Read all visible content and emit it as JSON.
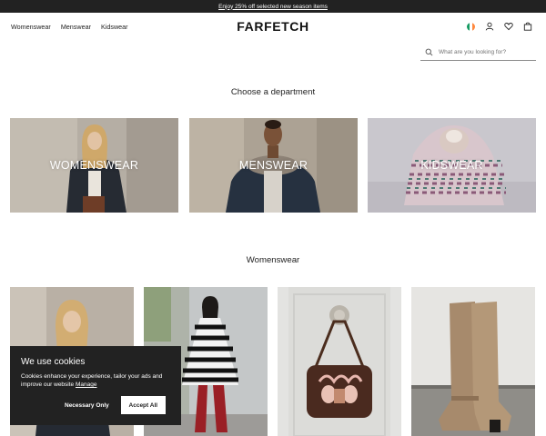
{
  "promo": {
    "text": "Enjoy 25% off selected new season items"
  },
  "header": {
    "nav": [
      "Womenswear",
      "Menswear",
      "Kidswear"
    ],
    "logo": "FARFETCH",
    "flag_colors": [
      "#169b62",
      "#ffffff",
      "#ff883e"
    ],
    "icons": [
      "account-icon",
      "wishlist-heart-icon",
      "shopping-bag-icon"
    ]
  },
  "search": {
    "placeholder": "What are you looking for?",
    "value": ""
  },
  "departments": {
    "title": "Choose a department",
    "tiles": [
      {
        "label": "WOMENSWEAR"
      },
      {
        "label": "MENSWEAR"
      },
      {
        "label": "KIDSWEAR"
      }
    ]
  },
  "womenswear": {
    "title": "Womenswear",
    "products": [
      "woman-in-dark-coat",
      "woman-in-striped-poncho-and-red-boots",
      "embroidered-shoulder-bag",
      "tan-suede-knee-boots"
    ]
  },
  "cookie_banner": {
    "title": "We use cookies",
    "body": "Cookies enhance your experience, tailor your ads and improve our website",
    "manage_link": "Manage",
    "necessary_button": "Necessary Only",
    "accept_button": "Accept All"
  }
}
